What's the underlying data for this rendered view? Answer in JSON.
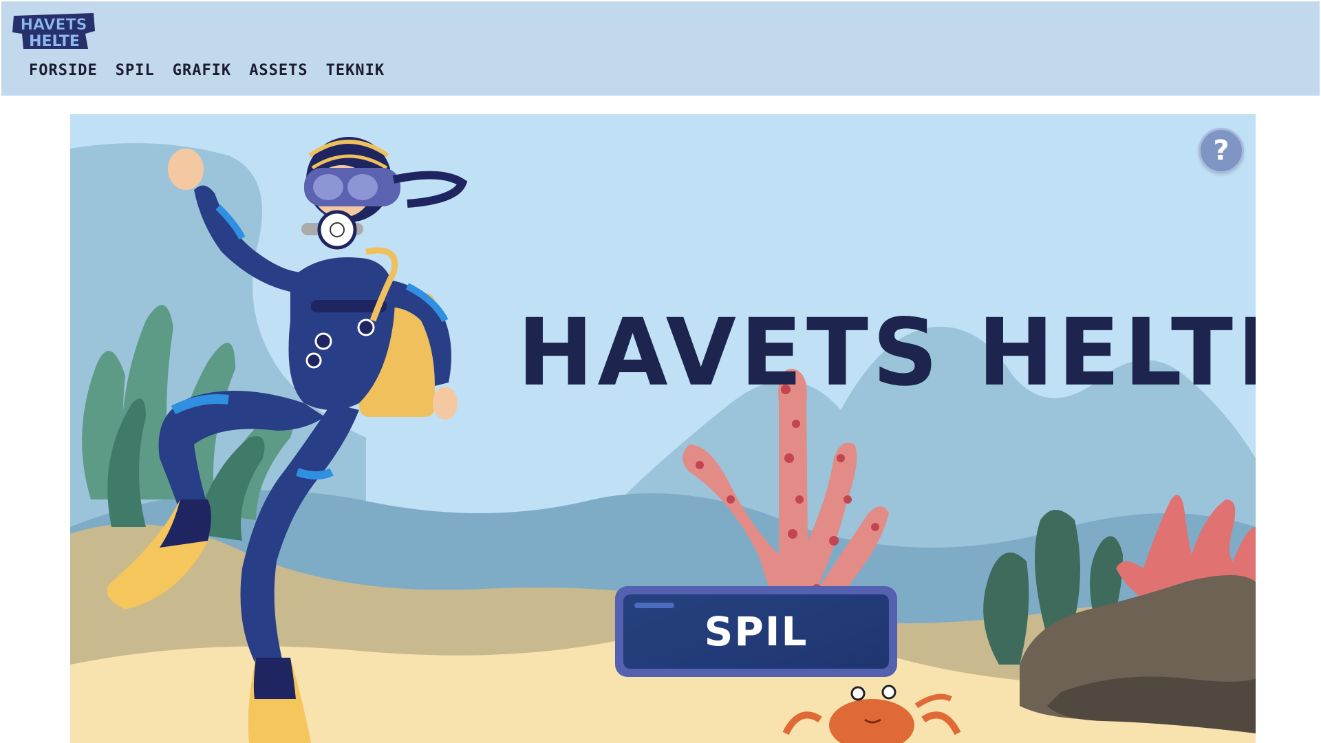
{
  "header": {
    "logo_text_line1": "HAVETS",
    "logo_text_line2": "HELTE",
    "nav": [
      "FORSIDE",
      "SPIL",
      "GRAFIK",
      "ASSETS",
      "TEKNIK"
    ]
  },
  "game": {
    "title": "HAVETS HELTE",
    "play_label": "SPIL",
    "help_label": "?"
  },
  "colors": {
    "header_bg": "#c2d8ec",
    "title": "#1d244d",
    "button_border": "#5460b0",
    "button_fill": "#223b78",
    "sky": "#c0e0f5",
    "sand": "#f8e2ae"
  },
  "icons": [
    "logo",
    "help-icon"
  ]
}
